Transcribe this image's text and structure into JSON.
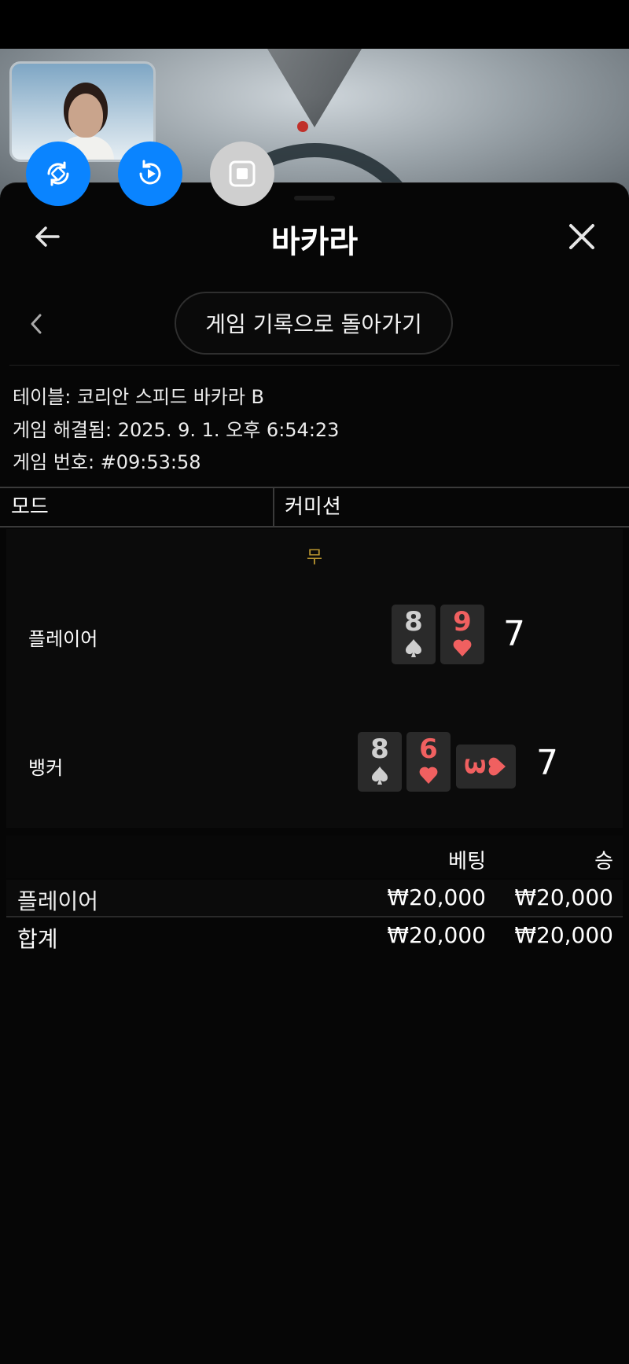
{
  "header": {
    "title": "바카라",
    "back_history_label": "게임 기록으로 돌아가기"
  },
  "info": {
    "table": "테이블: 코리안 스피드 바카라 B",
    "resolved": "게임 해결됨: 2025. 9. 1. 오후 6:54:23",
    "game_number": "게임 번호: #09:53:58"
  },
  "mode_row": {
    "mode_label": "모드",
    "mode_value": "커미션"
  },
  "result": {
    "outcome": "무",
    "player": {
      "label": "플레이어",
      "cards": [
        {
          "rank": "8",
          "suit": "spade"
        },
        {
          "rank": "9",
          "suit": "heart"
        }
      ],
      "score": "7"
    },
    "banker": {
      "label": "뱅커",
      "cards": [
        {
          "rank": "8",
          "suit": "spade"
        },
        {
          "rank": "6",
          "suit": "heart"
        },
        {
          "rank": "3",
          "suit": "heart",
          "sideways": true
        }
      ],
      "score": "7"
    }
  },
  "bets": {
    "columns": [
      "베팅",
      "승"
    ],
    "rows": [
      {
        "name": "플레이어",
        "bet": "₩20,000",
        "win": "₩20,000"
      }
    ],
    "total": {
      "name": "합계",
      "bet": "₩20,000",
      "win": "₩20,000"
    }
  },
  "icons": {
    "fab1": "rotate-screen-icon",
    "fab2": "replay-icon",
    "fab3": "stop-icon",
    "back": "arrow-left-icon",
    "close": "close-icon",
    "prev": "chevron-left-icon"
  },
  "colors": {
    "accent_blue": "#0a84ff",
    "heart_red": "#f06060",
    "tie_gold": "#b8942f"
  }
}
